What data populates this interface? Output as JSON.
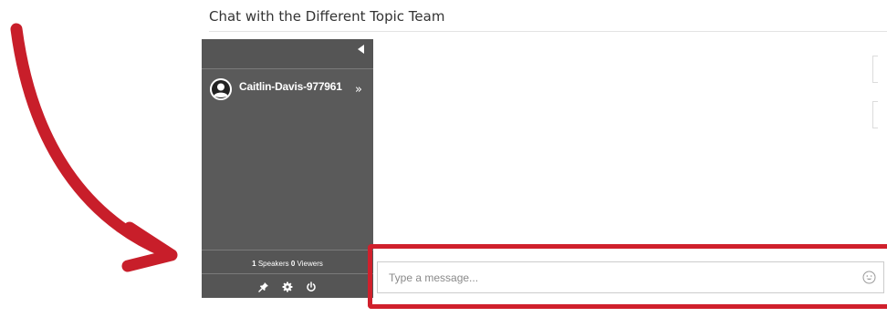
{
  "page": {
    "title": "Chat with the Different Topic Team"
  },
  "sidebar": {
    "user": {
      "name": "Caitlin-Davis-977961"
    },
    "expand_symbol": "»",
    "speakers_count": "1",
    "speakers_label": "Speakers",
    "viewers_count": "0",
    "viewers_label": "Viewers",
    "footer_icons": [
      "pin-icon",
      "gear-icon",
      "power-icon"
    ]
  },
  "composer": {
    "placeholder": "Type a message..."
  },
  "colors": {
    "sidebar_bg": "#5a5a5a",
    "annotation_red": "#d0202c"
  }
}
